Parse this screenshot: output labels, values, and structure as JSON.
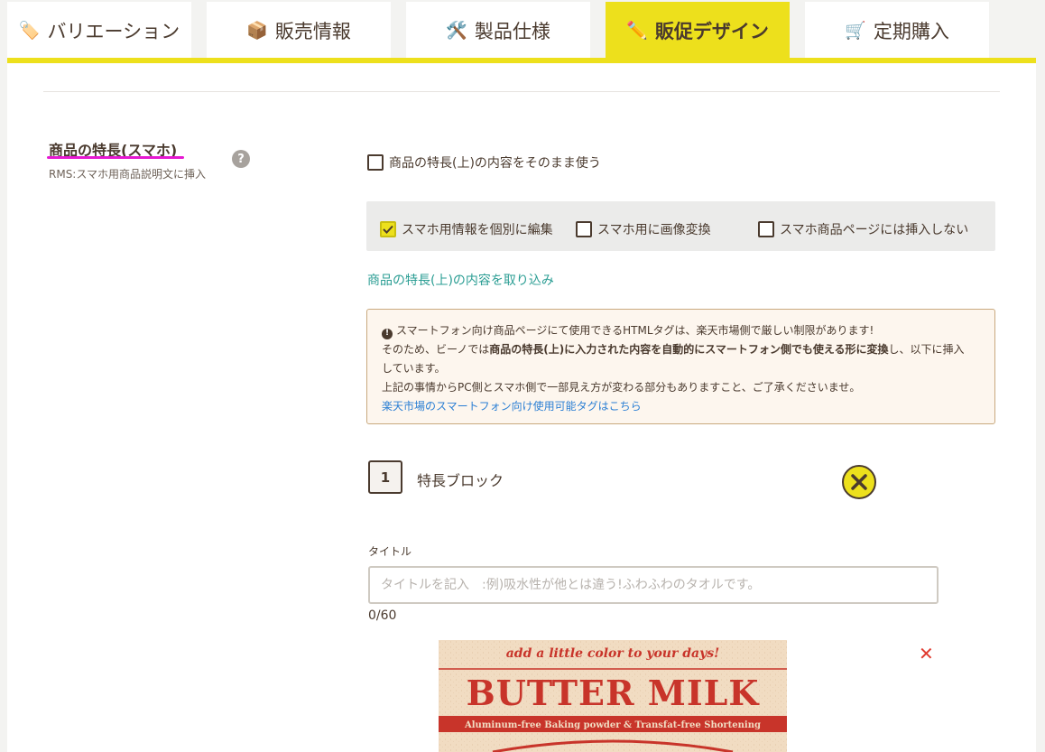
{
  "tabs": [
    {
      "label": "バリエーション",
      "icon": "tag-icon",
      "glyph": "🏷️",
      "active": false
    },
    {
      "label": "販売情報",
      "icon": "package-icon",
      "glyph": "📦",
      "active": false
    },
    {
      "label": "製品仕様",
      "icon": "tools-icon",
      "glyph": "🛠️",
      "active": false
    },
    {
      "label": "販促デザイン",
      "icon": "pencil-icon",
      "glyph": "✏️",
      "active": true
    },
    {
      "label": "定期購入",
      "icon": "cart-icon",
      "glyph": "🛒",
      "active": false
    }
  ],
  "section": {
    "title": "商品の特長(スマホ)",
    "subtitle": "RMS:スマホ用商品説明文に挿入",
    "help_glyph": "?"
  },
  "options": {
    "use_same": {
      "label": "商品の特長(上)の内容をそのまま使う",
      "checked": false
    },
    "individual_edit": {
      "label": "スマホ用情報を個別に編集",
      "checked": true
    },
    "image_convert": {
      "label": "スマホ用に画像変換",
      "checked": false
    },
    "no_insert": {
      "label": "スマホ商品ページには挿入しない",
      "checked": false
    }
  },
  "import_link": "商品の特長(上)の内容を取り込み",
  "notice": {
    "warn_glyph": "!",
    "line1": "スマートフォン向け商品ページにて使用できるHTMLタグは、楽天市場側で厳しい制限があります!",
    "line2_pre": "そのため、ビーノでは",
    "line2_bold": "商品の特長(上)に入力された内容を自動的にスマートフォン側でも使える形に変換",
    "line2_post": "し、以下に挿入",
    "line3": "しています。",
    "line4": "上記の事情からPC側とスマホ側で一部見え方が変わる部分もありますこと、ご了承くださいませ。",
    "link": "楽天市場のスマートフォン向け使用可能タグはこちら"
  },
  "block": {
    "number": "1",
    "label": "特長ブロック"
  },
  "title_field": {
    "label": "タイトル",
    "value": "",
    "placeholder": "タイトルを記入　:例)吸水性が他とは違う!ふわふわのタオルです。",
    "counter": "0/60"
  },
  "product_image": {
    "tagline": "add a little color to your days!",
    "name": "BUTTER MILK",
    "subline": "Aluminum-free Baking powder & Transfat-free Shortening",
    "remove_glyph": "✕",
    "colors": {
      "bg": "#f1dcc2",
      "ink": "#c8342a"
    }
  }
}
